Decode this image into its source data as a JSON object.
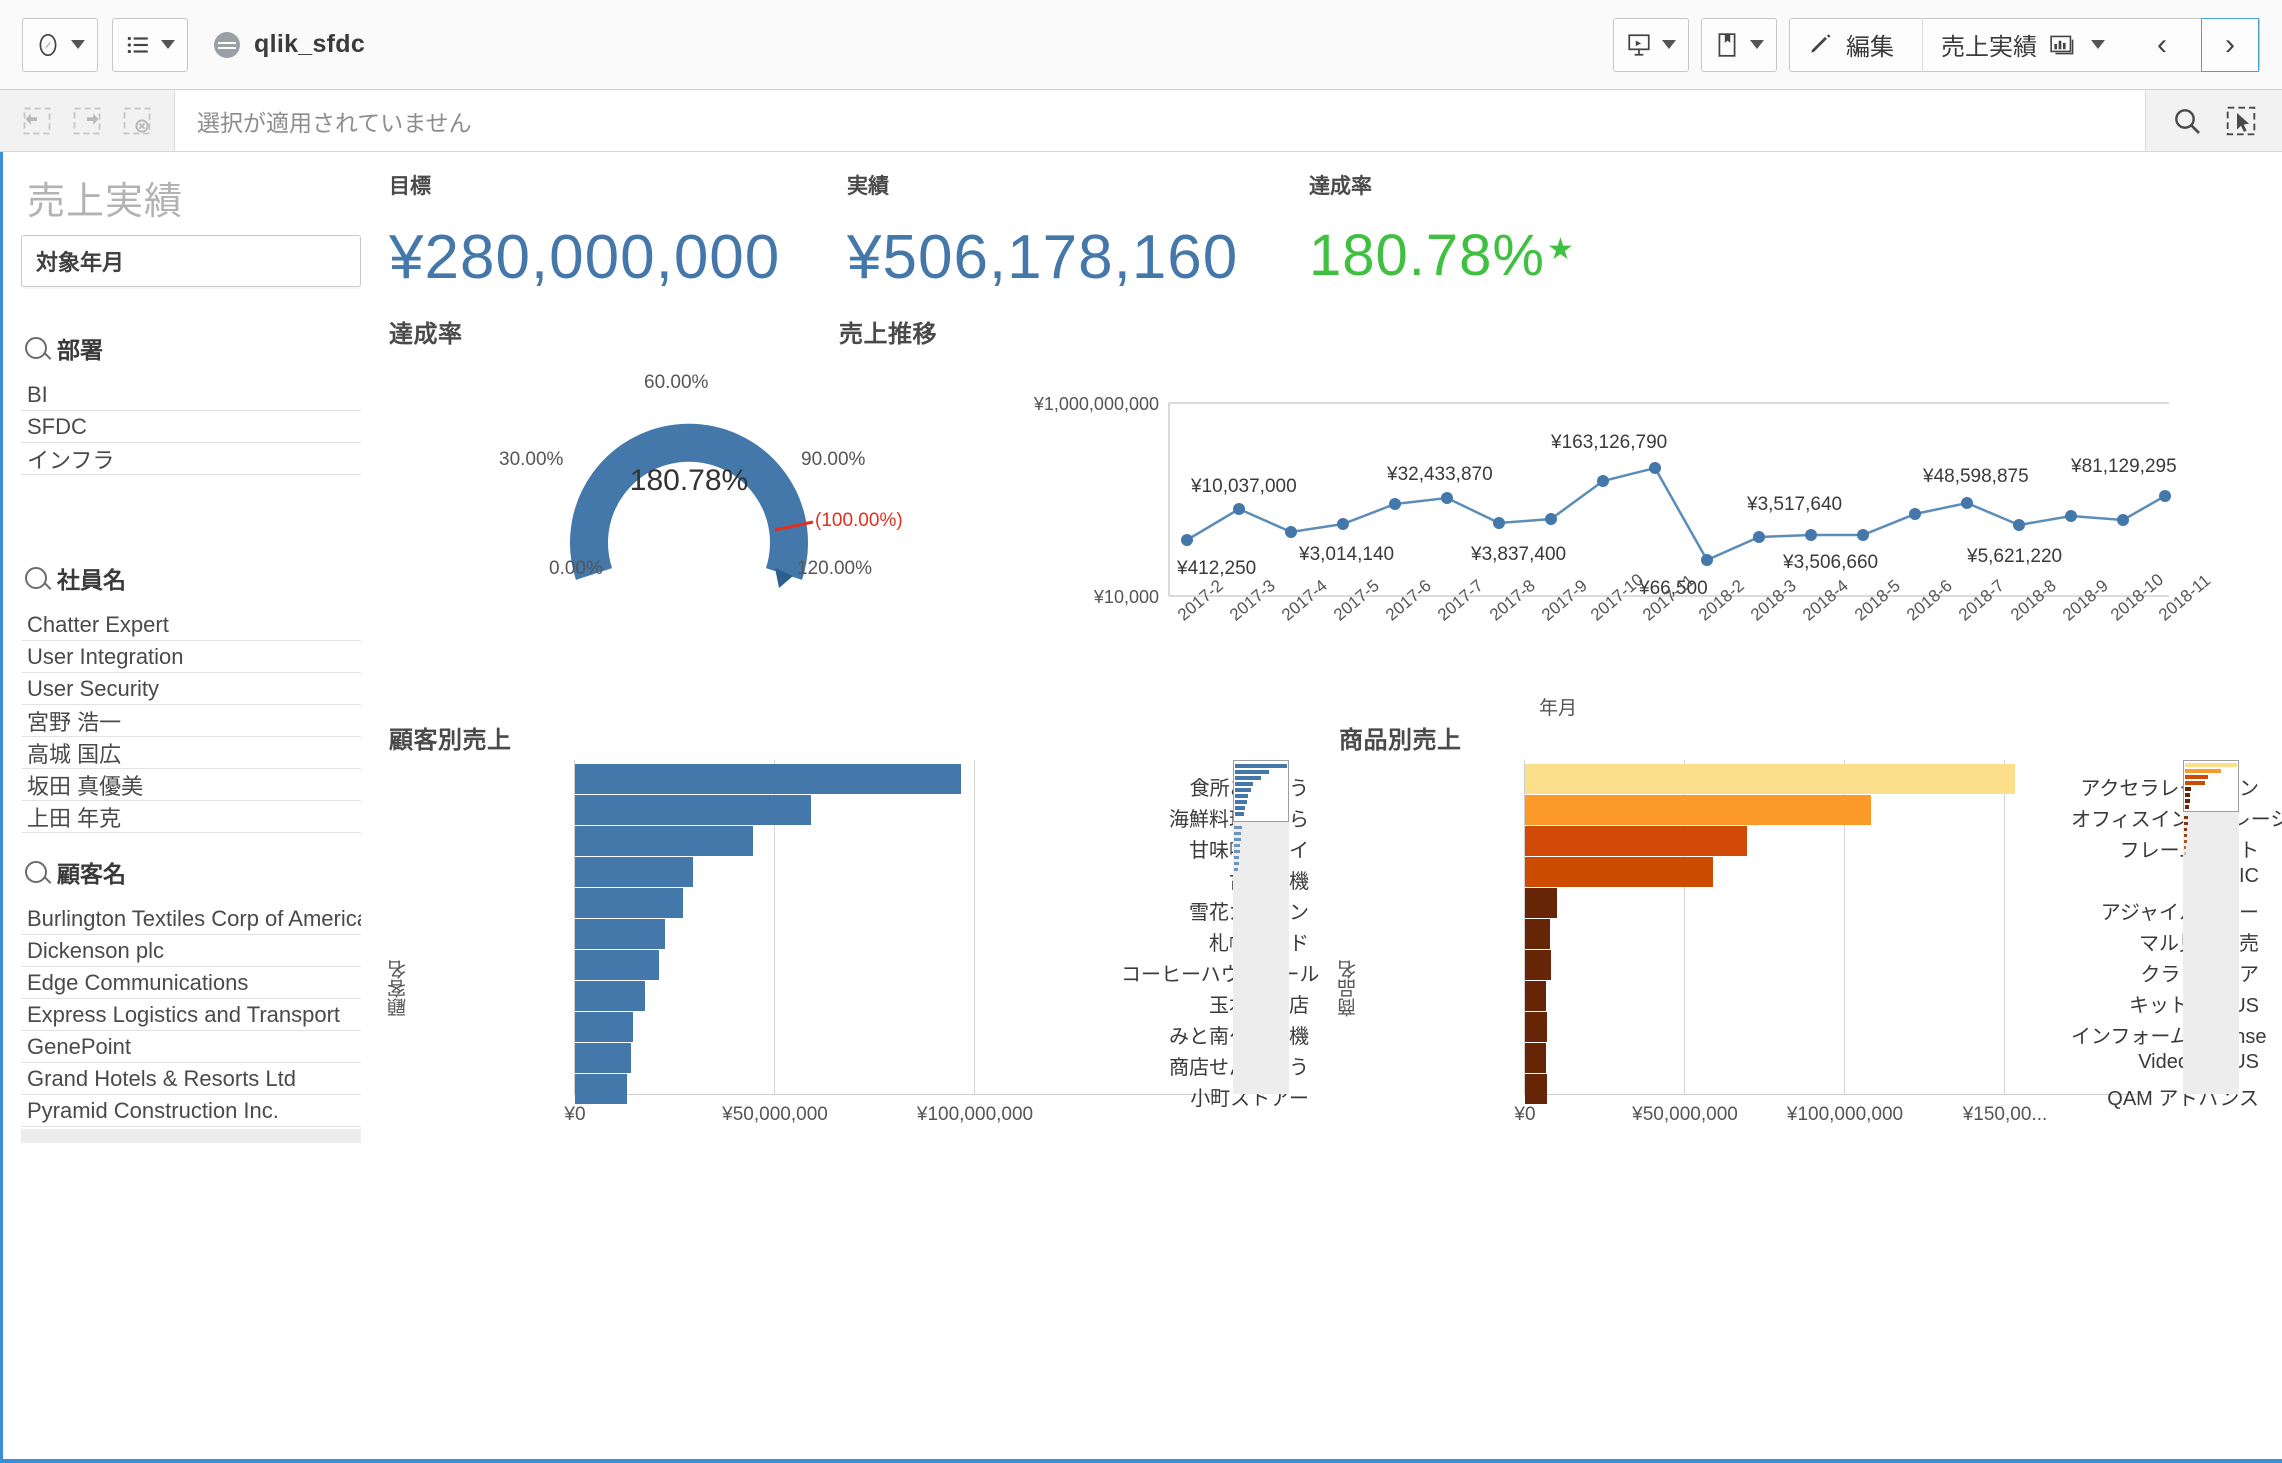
{
  "topbar": {
    "nav_icon": "compass-icon",
    "menu_icon": "list-icon",
    "app_icon": "sfdc-app-icon",
    "app_name": "qlik_sfdc",
    "story_icon": "storytelling-icon",
    "bookmark_icon": "bookmark-icon",
    "edit_icon": "pencil-icon",
    "edit_label": "編集",
    "sheet_label": "売上実績",
    "sheet_icon": "sheet-icon",
    "prev_label": "‹",
    "next_label": "›"
  },
  "selectionbar": {
    "back_icon": "step-back-icon",
    "forward_icon": "step-forward-icon",
    "clear_icon": "clear-selections-icon",
    "status_text": "選択が適用されていません",
    "search_icon": "search-icon",
    "selection_tool_icon": "selection-tool-icon"
  },
  "sheet": {
    "title": "売上実績"
  },
  "filters": {
    "period_input": {
      "name": "対象年月",
      "value": "対象年月"
    },
    "lists": [
      {
        "title": "部署",
        "search_icon": "search-icon",
        "items": [
          "BI",
          "SFDC",
          "インフラ"
        ]
      },
      {
        "title": "社員名",
        "search_icon": "search-icon",
        "items": [
          "Chatter Expert",
          "User Integration",
          "User Security",
          "宮野 浩一",
          "高城 国広",
          "坂田 真優美",
          "上田 年克"
        ]
      },
      {
        "title": "顧客名",
        "search_icon": "search-icon",
        "items": [
          "Burlington Textiles Corp of America",
          "Dickenson plc",
          "Edge Communications",
          "Express Logistics and Transport",
          "GenePoint",
          "Grand Hotels & Resorts Ltd",
          "Pyramid Construction Inc."
        ]
      }
    ]
  },
  "kpis": [
    {
      "label": "目標",
      "value": "¥280,000,000",
      "color": "#4477aa",
      "star": ""
    },
    {
      "label": "実績",
      "value": "¥506,178,160",
      "color": "#4477aa",
      "star": ""
    },
    {
      "label": "達成率",
      "value": "180.78%",
      "color": "#40c040",
      "star": "★"
    }
  ],
  "chart_data": [
    {
      "id": "gauge",
      "type": "gauge",
      "title": "達成率",
      "value": 180.78,
      "value_label": "180.78%",
      "min": 0,
      "max": 120,
      "ticks": [
        "0.00%",
        "30.00%",
        "60.00%",
        "90.00%",
        "120.00%"
      ],
      "tick_values": [
        0,
        30,
        60,
        90,
        120
      ],
      "target_label": "(100.00%)",
      "target_value": 100,
      "color": "#4477aa",
      "target_color": "#e03020",
      "ylabel": "",
      "xlabel": ""
    },
    {
      "id": "sales-trend",
      "type": "line",
      "title": "売上推移",
      "xlabel": "年月",
      "ylabel": "",
      "yscale": "log",
      "ylim": [
        10000,
        1000000000
      ],
      "ytick_labels": [
        "¥1,000,000,000",
        "¥10,000"
      ],
      "grid": false,
      "legend": "none",
      "color": "#4477aa",
      "categories": [
        "2017-2",
        "2017-3",
        "2017-4",
        "2017-5",
        "2017-6",
        "2017-7",
        "2017-8",
        "2017-9",
        "2017-10",
        "2017-11",
        "2018-2",
        "2018-3",
        "2018-4",
        "2018-5",
        "2018-6",
        "2018-7",
        "2018-8",
        "2018-9",
        "2018-10",
        "2018-11"
      ],
      "values": [
        412250,
        10037000,
        3014140,
        6500000,
        20000000,
        32433870,
        3837400,
        5500000,
        60000000,
        163126790,
        66500,
        3517640,
        3506660,
        3500000,
        20000000,
        48598875,
        5621220,
        15000000,
        12000000,
        81129295
      ],
      "point_labels": [
        {
          "category": "2017-2",
          "label": "¥412,250"
        },
        {
          "category": "2017-3",
          "label": "¥10,037,000"
        },
        {
          "category": "2017-5",
          "label": "¥3,014,140"
        },
        {
          "category": "2017-7",
          "label": "¥32,433,870"
        },
        {
          "category": "2017-8",
          "label": "¥3,837,400"
        },
        {
          "category": "2017-11",
          "label": "¥163,126,790"
        },
        {
          "category": "2018-2",
          "label": "¥66,500"
        },
        {
          "category": "2018-3",
          "label": "¥3,517,640"
        },
        {
          "category": "2018-4",
          "label": "¥3,506,660"
        },
        {
          "category": "2018-7",
          "label": "¥48,598,875"
        },
        {
          "category": "2018-8",
          "label": "¥5,621,220"
        },
        {
          "category": "2018-11",
          "label": "¥81,129,295"
        }
      ]
    },
    {
      "id": "sales-by-customer",
      "type": "bar",
      "orientation": "horizontal",
      "title": "顧客別売上",
      "ylabel": "顧客名",
      "xlabel": "",
      "xtick_labels": [
        "¥0",
        "¥50,000,000",
        "¥100,000,000"
      ],
      "xtick_values": [
        0,
        50000000,
        100000000
      ],
      "xlim": [
        0,
        120000000
      ],
      "color": "#4477aa",
      "categories": [
        "食所あんどう",
        "海鮮料理くじら",
        "甘味喫茶ダイ",
        "古川電機",
        "雪花ガーデン",
        "札幌フード",
        "コーヒーハウスアール",
        "玉本電気店",
        "みと南ケ丘電機",
        "商店せんしょう",
        "小町ストアー"
      ],
      "values": [
        95000000,
        58000000,
        44000000,
        29000000,
        26000000,
        22000000,
        21000000,
        18000000,
        15000000,
        14500000,
        13000000
      ]
    },
    {
      "id": "sales-by-product",
      "type": "bar",
      "orientation": "horizontal",
      "title": "商品別売上",
      "ylabel": "商品名",
      "xlabel": "",
      "xtick_labels": [
        "¥0",
        "¥50,000,000",
        "¥100,000,000",
        "¥150,00..."
      ],
      "xtick_values": [
        0,
        50000000,
        100000000,
        150000000
      ],
      "xlim": [
        0,
        165000000
      ],
      "categories": [
        "アクセラレーション",
        "オフィスインテグレーシ...",
        "フレームソート",
        "QBIC",
        "アジャイルビュー",
        "マル見え販売",
        "クラウディア",
        "キットFOCUS",
        "インフォームドSense",
        "VideoFOCUS",
        "QAM アドバンス"
      ],
      "values": [
        152000000,
        107000000,
        69000000,
        58000000,
        10000000,
        8000000,
        8500000,
        6500000,
        6800000,
        6500000,
        6800000
      ],
      "colors": [
        "#fcdf8a",
        "#fb9a29",
        "#d24a07",
        "#cc4c02",
        "#662506",
        "#662506",
        "#662506",
        "#662506",
        "#662506",
        "#662506",
        "#662506"
      ]
    }
  ]
}
